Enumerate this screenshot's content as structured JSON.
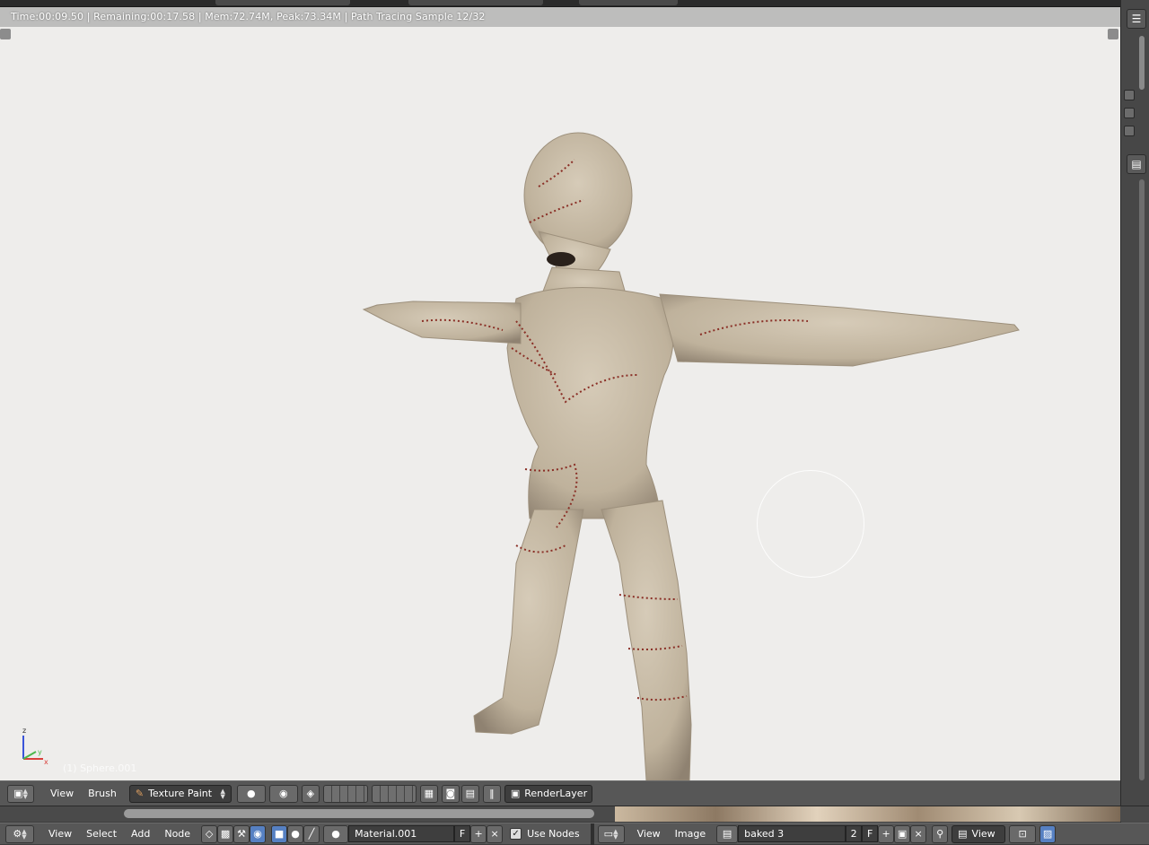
{
  "render": {
    "info": "Time:00:09.50 | Remaining:00:17.58 | Mem:72.74M, Peak:73.34M | Path Tracing Sample 12/32",
    "object_name": "(1) Sphere.001",
    "axis_z": "z",
    "axis_x": "x",
    "axis_y": "y"
  },
  "view3d_header": {
    "view": "View",
    "brush": "Brush",
    "mode": "Texture Paint",
    "render_layer": "RenderLayer"
  },
  "node_header": {
    "view": "View",
    "select": "Select",
    "add": "Add",
    "node": "Node",
    "material": "Material.001",
    "material_fake": "F",
    "use_nodes": "Use Nodes"
  },
  "image_header": {
    "view": "View",
    "image": "Image",
    "image_name": "baked 3",
    "users": "2",
    "fake": "F",
    "view_mode": "View"
  },
  "colors": {
    "viewport_bg": "#eeedeb",
    "header_bg": "#575757",
    "skin": "#c9bda9",
    "stitch": "#8a2f26"
  }
}
